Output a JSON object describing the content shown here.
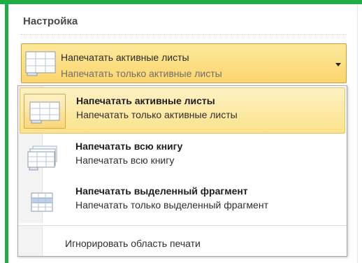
{
  "settings": {
    "title": "Настройка"
  },
  "combo": {
    "title": "Напечатать активные листы",
    "subtitle": "Напечатать только активные листы",
    "icon": "sheet-icon"
  },
  "options": [
    {
      "title": "Напечатать активные листы",
      "subtitle": "Напечатать только активные листы",
      "icon": "active-sheets-icon",
      "selected": true
    },
    {
      "title": "Напечатать всю книгу",
      "subtitle": "Напечатать всю книгу",
      "icon": "workbook-icon",
      "selected": false
    },
    {
      "title": "Напечатать выделенный фрагмент",
      "subtitle": "Напечатать только выделенный фрагмент",
      "icon": "selection-icon",
      "selected": false
    }
  ],
  "ignore_print_area": {
    "label": "Игнорировать область печати"
  },
  "colors": {
    "accent_green": "#1fad44",
    "highlight": "#fce28a",
    "highlight_border": "#e8c25e"
  }
}
